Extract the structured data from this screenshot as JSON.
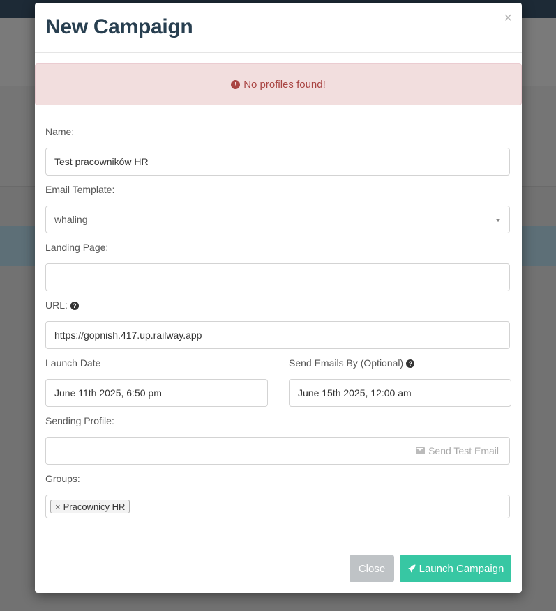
{
  "modal": {
    "title": "New Campaign",
    "close_symbol": "×"
  },
  "alert": {
    "icon": "exclamation-circle-icon",
    "message": "No profiles found!"
  },
  "form": {
    "name_label": "Name:",
    "name_value": "Test pracowników HR",
    "template_label": "Email Template:",
    "template_value": "whaling",
    "landing_label": "Landing Page:",
    "landing_value": "",
    "url_label": "URL:",
    "url_value": "https://gopnish.417.up.railway.app",
    "launch_date_label": "Launch Date",
    "launch_date_value": "June 11th 2025, 6:50 pm",
    "send_by_label": "Send Emails By (Optional)",
    "send_by_value": "June 15th 2025, 12:00 am",
    "sending_profile_label": "Sending Profile:",
    "sending_profile_value": "",
    "send_test_label": "Send Test Email",
    "groups_label": "Groups:",
    "groups": [
      {
        "remove_symbol": "×",
        "label": "Pracownicy HR"
      }
    ]
  },
  "footer": {
    "close_label": "Close",
    "launch_label": "Launch Campaign"
  },
  "colors": {
    "alert_bg": "#f2dede",
    "alert_text": "#a94442",
    "launch_button": "#37c7a3",
    "close_button": "#bfc3c6",
    "title": "#283f50"
  }
}
